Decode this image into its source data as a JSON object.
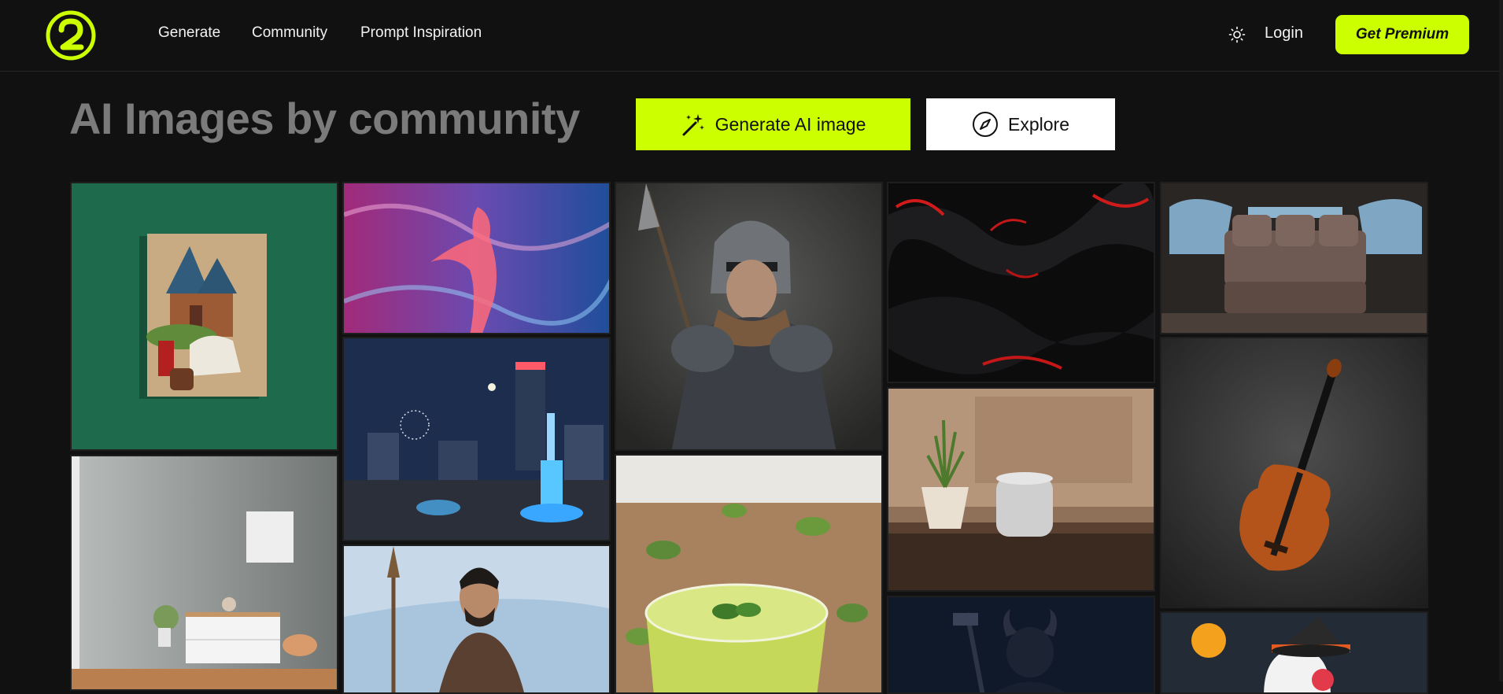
{
  "header": {
    "logo_label": "2",
    "nav": [
      "Generate",
      "Community",
      "Prompt Inspiration"
    ],
    "theme_icon": "sun-icon",
    "login_label": "Login",
    "premium_label": "Get Premium"
  },
  "hero": {
    "title": "AI Images by community",
    "generate_label": "Generate AI image",
    "generate_icon": "magic-wand-icon",
    "explore_label": "Explore",
    "explore_icon": "compass-icon"
  },
  "colors": {
    "accent": "#ccff00",
    "background": "#111111",
    "title_gray": "#7b7b7b"
  },
  "gallery": [
    "painting-church-on-green-wall",
    "cosmic-woman-in-nebula",
    "armored-knight-with-spear",
    "black-red-silk-fabric",
    "luxury-car-interior",
    "city-night-fireworks-statue",
    "violin-on-dark-background",
    "gray-room-interior",
    "smart-speaker-with-plant",
    "green-juice-with-mint",
    "bearded-man-with-spear",
    "dark-horned-warrior-with-axe",
    "halloween-ghost-with-witch-hat"
  ]
}
